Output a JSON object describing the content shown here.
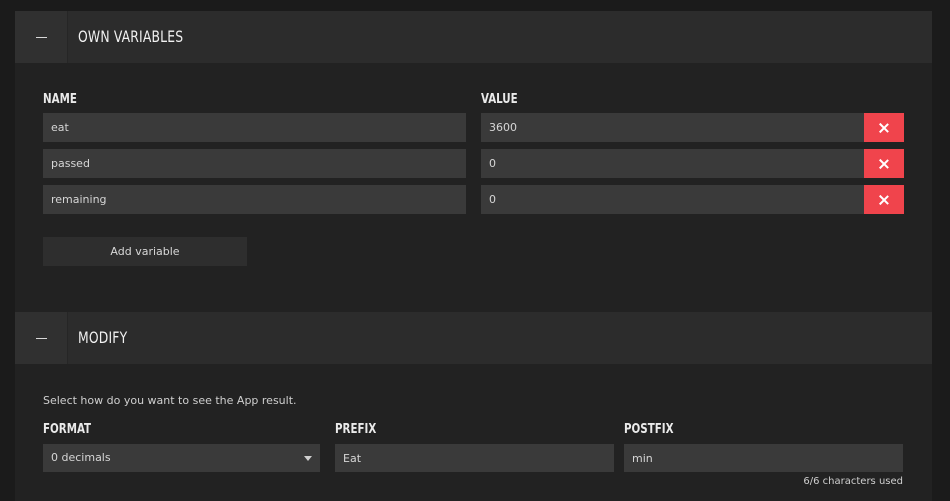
{
  "own_variables": {
    "title": "OWN VARIABLES",
    "name_label": "NAME",
    "value_label": "VALUE",
    "rows": [
      {
        "name": "eat",
        "value": "3600"
      },
      {
        "name": "passed",
        "value": "0"
      },
      {
        "name": "remaining",
        "value": "0"
      }
    ],
    "add_button": "Add variable"
  },
  "modify": {
    "title": "MODIFY",
    "description": "Select how do you want to see the App result.",
    "format_label": "FORMAT",
    "format_value": "0 decimals",
    "prefix_label": "PREFIX",
    "prefix_value": "Eat",
    "postfix_label": "POSTFIX",
    "postfix_value": "min",
    "counter": "6/6 characters used"
  },
  "icons": {
    "collapse": "minus-icon",
    "remove": "close-icon",
    "dropdown": "chevron-down-icon"
  },
  "colors": {
    "danger": "#f0444c",
    "panel_header": "#2c2c2c",
    "input_bg": "#3a3a3a"
  }
}
